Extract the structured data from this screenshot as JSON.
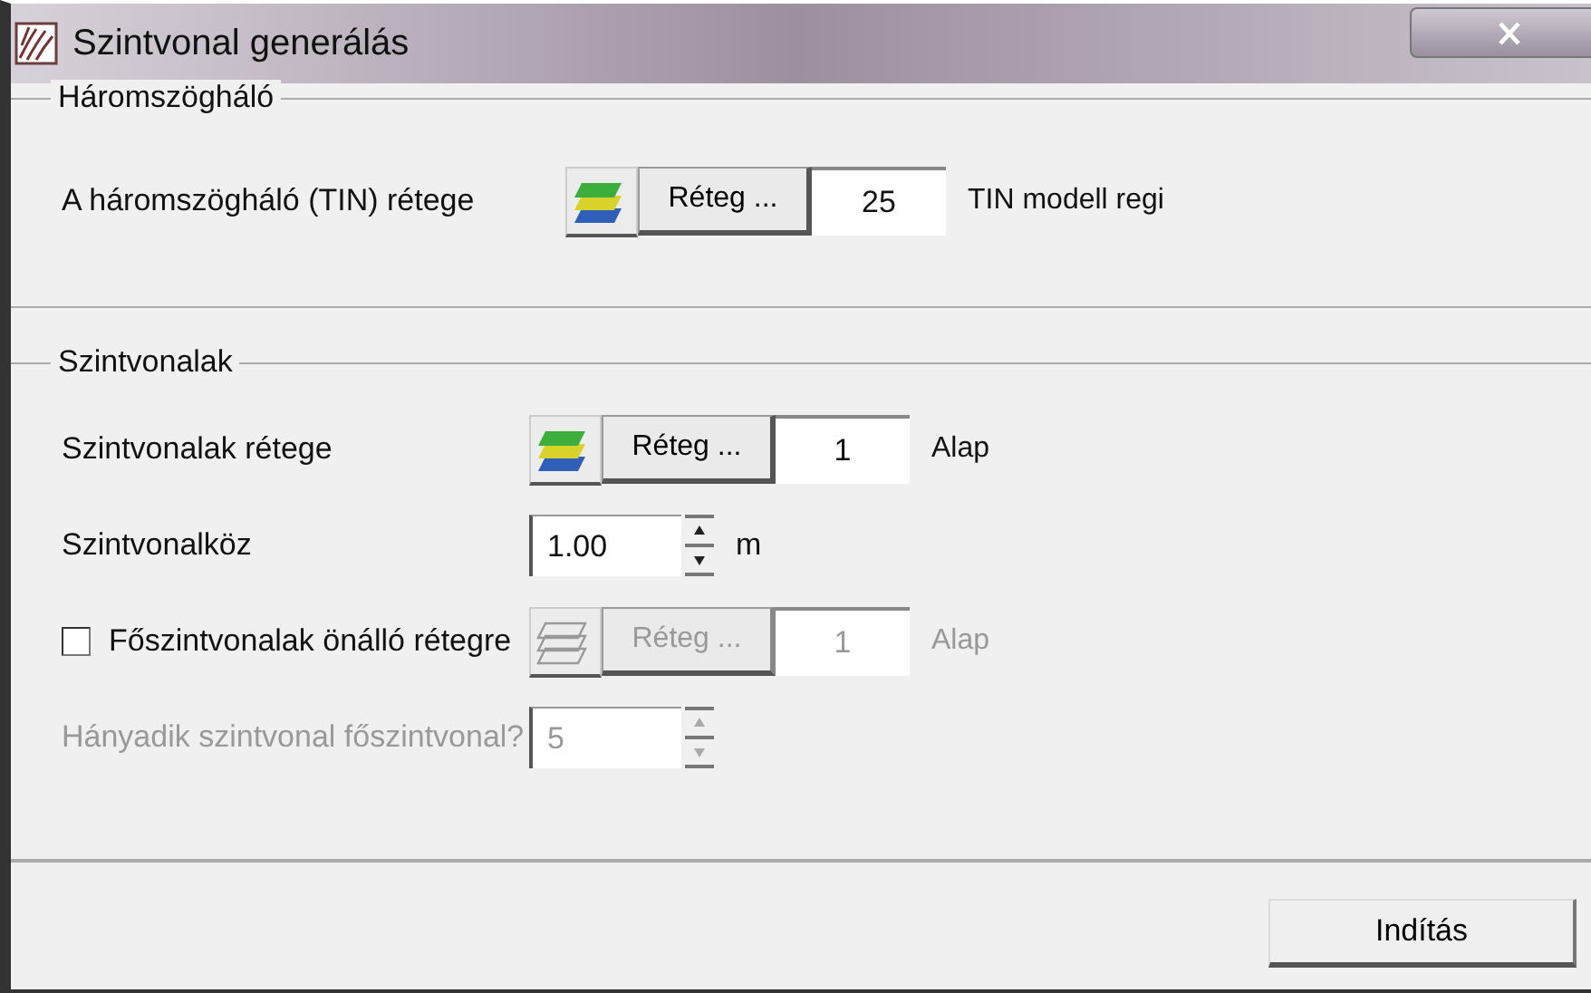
{
  "window": {
    "title": "Szintvonal generálás"
  },
  "groups": [
    {
      "title": "Háromszögháló",
      "rows": [
        {
          "kind": "layer",
          "label": "A háromszögháló (TIN) rétege",
          "button": "Réteg ...",
          "number": "25",
          "layer_name": "TIN modell regi",
          "disabled": false
        }
      ]
    },
    {
      "title": "Szintvonalak",
      "rows": [
        {
          "kind": "layer",
          "label": "Szintvonalak rétege",
          "button": "Réteg ...",
          "number": "1",
          "layer_name": "Alap",
          "disabled": false
        },
        {
          "kind": "spin",
          "label": "Szintvonalköz",
          "value": "1.00",
          "unit": "m",
          "disabled": false
        },
        {
          "kind": "checkbox_layer",
          "label": "Főszintvonalak önálló rétegre",
          "checked": false,
          "button": "Réteg ...",
          "number": "1",
          "layer_name": "Alap",
          "disabled": true
        },
        {
          "kind": "spin",
          "label": "Hányadik szintvonal főszintvonal?",
          "value": "5",
          "disabled": true
        }
      ]
    }
  ],
  "buttons": [
    "Indítás"
  ]
}
